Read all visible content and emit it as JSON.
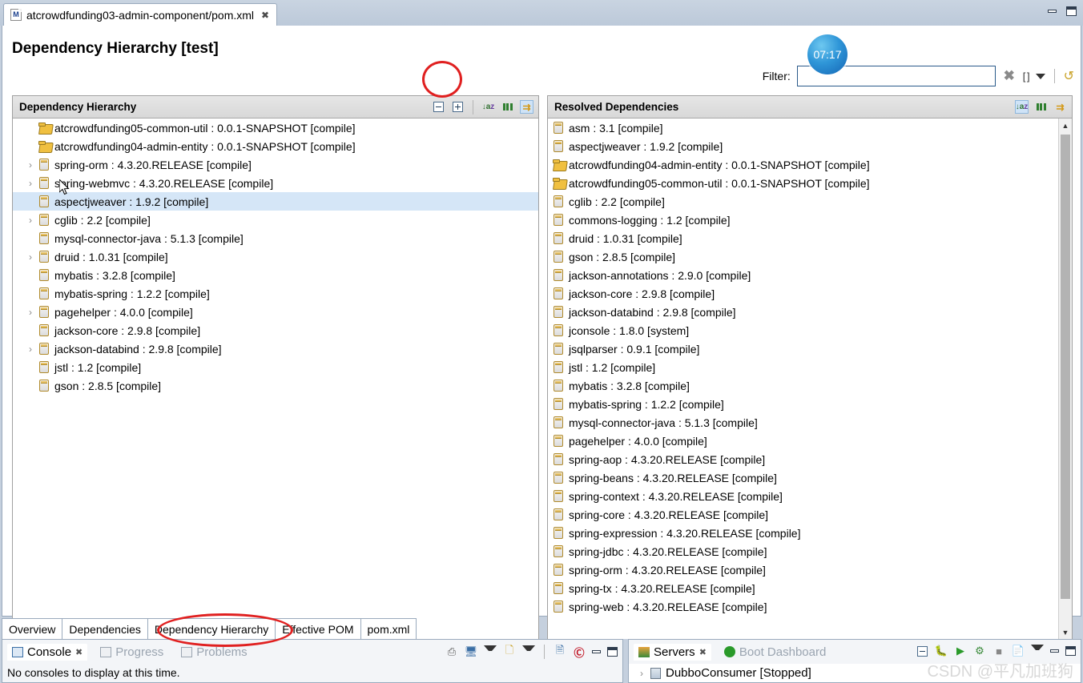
{
  "window": {
    "minimize_icon": "minimize-icon",
    "maximize_icon": "maximize-icon"
  },
  "editor_tab": {
    "icon": "maven-pom-icon",
    "label": "atcrowdfunding03-admin-component/pom.xml",
    "close": "✖"
  },
  "form": {
    "title": "Dependency Hierarchy [test]",
    "filter": {
      "label": "Filter:",
      "value": "",
      "placeholder": "",
      "clear_icon": "clear-icon",
      "brackets_icon": "brackets-icon",
      "dropdown_icon": "chevron-down-icon",
      "refresh_icon": "refresh-icon"
    }
  },
  "left_panel": {
    "title": "Dependency Hierarchy",
    "tools": [
      {
        "name": "collapse-all-button",
        "icon": "collapse-all-icon"
      },
      {
        "name": "expand-all-button",
        "icon": "expand-all-icon"
      },
      {
        "name": "sort-button",
        "icon": "sort-az-icon"
      },
      {
        "name": "show-groupid-button",
        "icon": "columns-icon"
      },
      {
        "name": "link-with-editor-button",
        "icon": "link-arrows-icon"
      }
    ],
    "rows": [
      {
        "expand": "",
        "icon": "folder-icon",
        "text": "atcrowdfunding05-common-util : 0.0.1-SNAPSHOT [compile]",
        "selected": false
      },
      {
        "expand": "",
        "icon": "folder-icon",
        "text": "atcrowdfunding04-admin-entity : 0.0.1-SNAPSHOT [compile]",
        "selected": false
      },
      {
        "expand": "›",
        "icon": "jar-icon",
        "text": "spring-orm : 4.3.20.RELEASE [compile]",
        "selected": false
      },
      {
        "expand": "›",
        "icon": "jar-icon",
        "text": "spring-webmvc : 4.3.20.RELEASE [compile]",
        "selected": false
      },
      {
        "expand": "",
        "icon": "jar-icon",
        "text": "aspectjweaver : 1.9.2 [compile]",
        "selected": true
      },
      {
        "expand": "›",
        "icon": "jar-icon",
        "text": "cglib : 2.2 [compile]",
        "selected": false
      },
      {
        "expand": "",
        "icon": "jar-icon",
        "text": "mysql-connector-java : 5.1.3 [compile]",
        "selected": false
      },
      {
        "expand": "›",
        "icon": "jar-icon",
        "text": "druid : 1.0.31 [compile]",
        "selected": false
      },
      {
        "expand": "",
        "icon": "jar-icon",
        "text": "mybatis : 3.2.8 [compile]",
        "selected": false
      },
      {
        "expand": "",
        "icon": "jar-icon",
        "text": "mybatis-spring : 1.2.2 [compile]",
        "selected": false
      },
      {
        "expand": "›",
        "icon": "jar-icon",
        "text": "pagehelper : 4.0.0 [compile]",
        "selected": false
      },
      {
        "expand": "",
        "icon": "jar-icon",
        "text": "jackson-core : 2.9.8 [compile]",
        "selected": false
      },
      {
        "expand": "›",
        "icon": "jar-icon",
        "text": "jackson-databind : 2.9.8 [compile]",
        "selected": false
      },
      {
        "expand": "",
        "icon": "jar-icon",
        "text": "jstl : 1.2 [compile]",
        "selected": false
      },
      {
        "expand": "",
        "icon": "jar-icon",
        "text": "gson : 2.8.5 [compile]",
        "selected": false
      }
    ]
  },
  "right_panel": {
    "title": "Resolved Dependencies",
    "tools": [
      {
        "name": "sort-button",
        "icon": "sort-az-icon"
      },
      {
        "name": "show-groupid-button",
        "icon": "columns-icon"
      },
      {
        "name": "link-with-editor-button",
        "icon": "link-arrows-icon"
      }
    ],
    "rows": [
      {
        "icon": "jar-icon",
        "text": "asm : 3.1 [compile]"
      },
      {
        "icon": "jar-icon",
        "text": "aspectjweaver : 1.9.2 [compile]"
      },
      {
        "icon": "folder-icon",
        "text": "atcrowdfunding04-admin-entity : 0.0.1-SNAPSHOT [compile]"
      },
      {
        "icon": "folder-icon",
        "text": "atcrowdfunding05-common-util : 0.0.1-SNAPSHOT [compile]"
      },
      {
        "icon": "jar-icon",
        "text": "cglib : 2.2 [compile]"
      },
      {
        "icon": "jar-icon",
        "text": "commons-logging : 1.2 [compile]"
      },
      {
        "icon": "jar-icon",
        "text": "druid : 1.0.31 [compile]"
      },
      {
        "icon": "jar-icon",
        "text": "gson : 2.8.5 [compile]"
      },
      {
        "icon": "jar-icon",
        "text": "jackson-annotations : 2.9.0 [compile]"
      },
      {
        "icon": "jar-icon",
        "text": "jackson-core : 2.9.8 [compile]"
      },
      {
        "icon": "jar-icon",
        "text": "jackson-databind : 2.9.8 [compile]"
      },
      {
        "icon": "jar-icon",
        "text": "jconsole : 1.8.0 [system]"
      },
      {
        "icon": "jar-icon",
        "text": "jsqlparser : 0.9.1 [compile]"
      },
      {
        "icon": "jar-icon",
        "text": "jstl : 1.2 [compile]"
      },
      {
        "icon": "jar-icon",
        "text": "mybatis : 3.2.8 [compile]"
      },
      {
        "icon": "jar-icon",
        "text": "mybatis-spring : 1.2.2 [compile]"
      },
      {
        "icon": "jar-icon",
        "text": "mysql-connector-java : 5.1.3 [compile]"
      },
      {
        "icon": "jar-icon",
        "text": "pagehelper : 4.0.0 [compile]"
      },
      {
        "icon": "jar-icon",
        "text": "spring-aop : 4.3.20.RELEASE [compile]"
      },
      {
        "icon": "jar-icon",
        "text": "spring-beans : 4.3.20.RELEASE [compile]"
      },
      {
        "icon": "jar-icon",
        "text": "spring-context : 4.3.20.RELEASE [compile]"
      },
      {
        "icon": "jar-icon",
        "text": "spring-core : 4.3.20.RELEASE [compile]"
      },
      {
        "icon": "jar-icon",
        "text": "spring-expression : 4.3.20.RELEASE [compile]"
      },
      {
        "icon": "jar-icon",
        "text": "spring-jdbc : 4.3.20.RELEASE [compile]"
      },
      {
        "icon": "jar-icon",
        "text": "spring-orm : 4.3.20.RELEASE [compile]"
      },
      {
        "icon": "jar-icon",
        "text": "spring-tx : 4.3.20.RELEASE [compile]"
      },
      {
        "icon": "jar-icon",
        "text": "spring-web : 4.3.20.RELEASE [compile]"
      }
    ],
    "scrollbar": {
      "up_icon": "chevron-up-icon",
      "down_icon": "chevron-down-icon"
    }
  },
  "form_tabs": [
    {
      "label": "Overview",
      "active": false
    },
    {
      "label": "Dependencies",
      "active": false
    },
    {
      "label": "Dependency Hierarchy",
      "active": true
    },
    {
      "label": "Effective POM",
      "active": false
    },
    {
      "label": "pom.xml",
      "active": false
    }
  ],
  "console_view": {
    "tabs": [
      {
        "label": "Console",
        "icon": "console-icon",
        "active": true,
        "close": "✖"
      },
      {
        "label": "Progress",
        "icon": "progress-icon",
        "active": false
      },
      {
        "label": "Problems",
        "icon": "problems-icon",
        "active": false
      }
    ],
    "body": "No consoles to display at this time.",
    "tools": [
      {
        "name": "open-console-button",
        "icon": "open-console-icon"
      },
      {
        "name": "display-selected-console-button",
        "icon": "display-console-icon"
      },
      {
        "name": "display-selected-console-menu",
        "icon": "chevron-down-icon"
      },
      {
        "name": "new-console-view-button",
        "icon": "new-console-icon"
      },
      {
        "name": "new-console-view-menu",
        "icon": "chevron-down-icon"
      },
      {
        "name": "view-menu-button",
        "icon": "view-menu-icon"
      },
      {
        "name": "amaterasu-button",
        "icon": "circle-a-icon"
      },
      {
        "name": "minimize-view-button",
        "icon": "minimize-icon"
      },
      {
        "name": "maximize-view-button",
        "icon": "maximize-icon"
      }
    ]
  },
  "servers_view": {
    "tabs": [
      {
        "label": "Servers",
        "icon": "servers-icon",
        "active": true,
        "close": "✖"
      },
      {
        "label": "Boot Dashboard",
        "icon": "boot-dashboard-icon",
        "active": false
      }
    ],
    "rows": [
      {
        "expand": "›",
        "icon": "server-icon",
        "text": "DubboConsumer  [Stopped]"
      }
    ],
    "tools": [
      {
        "name": "collapse-all-button",
        "icon": "collapse-all-icon"
      },
      {
        "name": "debug-button",
        "icon": "debug-icon"
      },
      {
        "name": "start-button",
        "icon": "start-icon"
      },
      {
        "name": "profile-button",
        "icon": "profile-icon"
      },
      {
        "name": "stop-button",
        "icon": "stop-icon"
      },
      {
        "name": "publish-button",
        "icon": "publish-icon"
      },
      {
        "name": "view-menu-button",
        "icon": "chevron-down-icon"
      },
      {
        "name": "minimize-view-button",
        "icon": "minimize-icon"
      },
      {
        "name": "maximize-view-button",
        "icon": "maximize-icon"
      }
    ]
  },
  "overlays": {
    "timer_badge": "07:17",
    "watermark": "CSDN @平凡加班狗"
  }
}
